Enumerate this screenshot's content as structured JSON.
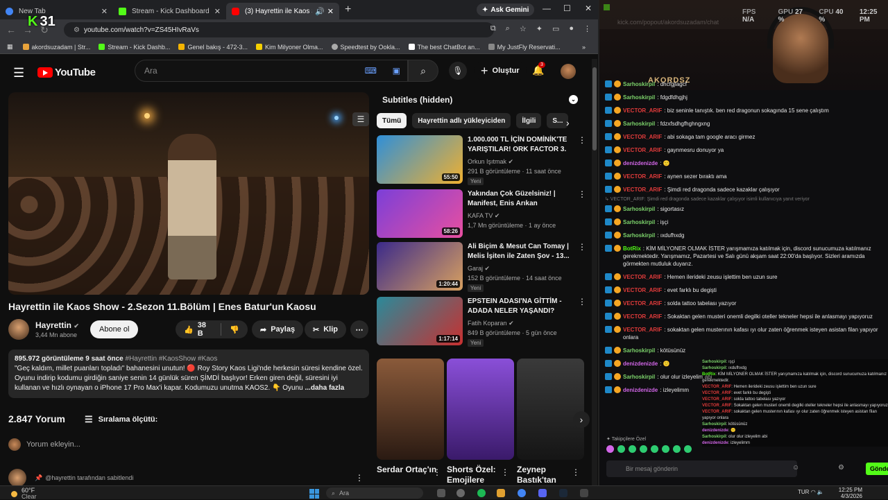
{
  "tabs": [
    {
      "title": "New Tab",
      "color": "#4285f4"
    },
    {
      "title": "Stream - Kick Dashboard",
      "color": "#53fc18"
    },
    {
      "title": "(3) Hayrettin ile Kaos Show",
      "color": "#ff0000"
    }
  ],
  "gemini_label": "Ask Gemini",
  "kick_overlay": {
    "k": "K",
    "num": "31"
  },
  "url": "youtube.com/watch?v=ZS45HIvRaVs",
  "bookmarks": [
    {
      "label": "akordsuzadam | Str...",
      "color": "#e8a33b"
    },
    {
      "label": "Stream - Kick Dashb...",
      "color": "#53fc18"
    },
    {
      "label": "Genel bakış - 472-3...",
      "color": "#f4b400"
    },
    {
      "label": "Kim Milyoner Olma...",
      "color": "#f5d000"
    },
    {
      "label": "Speedtest by Ookla...",
      "color": "#aaaaaa"
    },
    {
      "label": "The best ChatBot an...",
      "color": "#ffffff"
    },
    {
      "label": "My JustFly Reservati...",
      "color": "#888888"
    }
  ],
  "yt": {
    "logo": "YouTube",
    "search_placeholder": "Ara",
    "create_label": "Oluştur",
    "notif_count": "3"
  },
  "video": {
    "title": "Hayrettin ile Kaos Show - 2.Sezon 11.Bölüm | Enes Batur'un Kaosu",
    "channel": "Hayrettin",
    "subs": "3,44 Mn abone",
    "subscribe": "Abone ol",
    "likes": "38 B",
    "share": "Paylaş",
    "clip": "Klip",
    "desc_meta": "895.972 görüntüleme  9 saat önce",
    "desc_tags": "#Hayrettin #KaosShow #Kaos",
    "desc_text": "\"Geç kaldım, millet puanları topladı\" bahanesini unutun! 🔴 Roy Story Kaos Ligi'nde herkesin süresi kendine özel. Oyunu indirip kodumu girdiğin saniye senin 14 günlük süren ŞİMDİ başlıyor! Erken giren değil, süresini iyi kullanan ve hızlı oynayan o iPhone 17 Pro Max'i kapar. Kodumuzu unutma KAOS2. 👇 Oyunu",
    "desc_more": "...daha fazla",
    "comments_count": "2.847 Yorum",
    "sort_label": "Sıralama ölçütü:",
    "add_comment": "Yorum ekleyin...",
    "pinned": "@hayrettin tarafından sabitlendi"
  },
  "subtitles_header": "Subtitles (hidden)",
  "chips": [
    "Tümü",
    "Hayrettin adlı yükleyiciden",
    "İlgili",
    "S..."
  ],
  "recs": [
    {
      "title": "1.000.000 TL İÇİN DOMİNİK'TE YARIŞTILAR! ORK FACTOR 3. ...",
      "channel": "Orkun Işıtmak",
      "views": "291 B görüntüleme · 11 saat önce",
      "badge": "Yeni",
      "duration": "55:50",
      "c1": "#2f8fd8",
      "c2": "#f0b030"
    },
    {
      "title": "Yakından Çok Güzelsiniz! | Manifest, Enis Arıkan",
      "channel": "KAFA TV",
      "views": "1,7 Mn görüntüleme · 1 ay önce",
      "badge": "",
      "duration": "58:26",
      "c1": "#7b3fd8",
      "c2": "#e84fa0"
    },
    {
      "title": "Ali Biçim & Mesut Can Tomay | Melis İşiten ile Zaten Şov - 13...",
      "channel": "Garaj",
      "views": "152 B görüntüleme · 14 saat önce",
      "badge": "Yeni",
      "duration": "1:20:44",
      "c1": "#3b2a8a",
      "c2": "#d8a060"
    },
    {
      "title": "EPSTEIN ADASI'NA GİTTİM - ADADA NELER YAŞANDI?",
      "channel": "Fatih Koparan",
      "views": "849 B görüntüleme · 5 gün önce",
      "badge": "Yeni",
      "duration": "1:17:14",
      "c1": "#2a8a9a",
      "c2": "#c83030"
    }
  ],
  "shorts": [
    {
      "title": "Serdar Ortaç'ın",
      "c1": "#8a5a3a",
      "c2": "#2a1a12"
    },
    {
      "title": "Shorts Özel: Emojilere",
      "c1": "#8a4fd8",
      "c2": "#3a1a6a"
    },
    {
      "title": "Zeynep Bastık'tan",
      "c1": "#3a3a3a",
      "c2": "#151515"
    }
  ],
  "stream": {
    "url": "kick.com/popout/akordsuzadam/chat",
    "hud": [
      {
        "label": "FPS",
        "value": "N/A"
      },
      {
        "label": "GPU",
        "value": "27 %"
      },
      {
        "label": "CPU",
        "value": "40 %"
      },
      {
        "label": "",
        "value": "12:25 PM"
      }
    ],
    "cam_logo": "AKORDSZ",
    "chat": [
      {
        "type": "msg",
        "user": "Sarhoskirpil",
        "text": "dhcfgjlagcf",
        "color": "#7cd36b"
      },
      {
        "type": "msg",
        "user": "Sarhoskirpil",
        "text": "fdgdfdhgjhj",
        "color": "#7cd36b"
      },
      {
        "type": "msg",
        "user": "VECTOR_ARIF",
        "text": "biz seninle tanıştık. ben red dragonun sokagında 15 sene çalıştım",
        "color": "#e23b3b"
      },
      {
        "type": "msg",
        "user": "Sarhoskirpil",
        "text": "fdzxfsdhgfhghngxng",
        "color": "#7cd36b"
      },
      {
        "type": "msg",
        "user": "VECTOR_ARIF",
        "text": "abi sokaga tam google aracı girmez",
        "color": "#e23b3b"
      },
      {
        "type": "msg",
        "user": "VECTOR_ARIF",
        "text": "gaynmesru donuyor ya",
        "color": "#e23b3b"
      },
      {
        "type": "msg",
        "user": "denizdenizde",
        "text": "🙂",
        "color": "#d266e8"
      },
      {
        "type": "msg",
        "user": "VECTOR_ARIF",
        "text": "aynen sezer bıraktı ama",
        "color": "#e23b3b"
      },
      {
        "type": "msg",
        "user": "VECTOR_ARIF",
        "text": "Şimdi red dragonda sadece kazaklar çalışıyor",
        "color": "#e23b3b"
      },
      {
        "type": "reply",
        "text": "↳ VECTOR_ARIF: Şimdi red dragonda sadece kazaklar çalışıyor isimli kullanıcıya yanıt veriyor"
      },
      {
        "type": "msg",
        "user": "Sarhoskirpil",
        "text": "sigortasız",
        "color": "#7cd36b"
      },
      {
        "type": "msg",
        "user": "Sarhoskirpil",
        "text": "işçi",
        "color": "#7cd36b"
      },
      {
        "type": "msg",
        "user": "Sarhoskirpil",
        "text": "ıxdufhxdg",
        "color": "#7cd36b"
      },
      {
        "type": "msg",
        "user": "BotRix",
        "text": "KİM MİLYONER OLMAK İSTER yarışmamıza katılmak için, discord sunucumuza katılmanız gerekmektedir. Yarışmamız, Pazartesi ve Salı günü akşam saat 22:00'da başlıyor. Sizleri aramızda görmekten mutluluk duyarız.",
        "color": "#53fc18"
      },
      {
        "type": "msg",
        "user": "VECTOR_ARIF",
        "text": "Hemen ilerideki zeusu işlettim ben uzun sure",
        "color": "#e23b3b"
      },
      {
        "type": "msg",
        "user": "VECTOR_ARIF",
        "text": "evet farklı bu degişti",
        "color": "#e23b3b"
      },
      {
        "type": "msg",
        "user": "VECTOR_ARIF",
        "text": "solda tattoo tabelası yazıyor",
        "color": "#e23b3b"
      },
      {
        "type": "msg",
        "user": "VECTOR_ARIF",
        "text": "Sokaktan gelen musteri onemli degilki oteller tekneler hepsi ile anlasmayı yapıyoruz",
        "color": "#e23b3b"
      },
      {
        "type": "msg",
        "user": "VECTOR_ARIF",
        "text": "sokaktan gelen musterının kafası ıyı olur zaten öğrenmek isteyen asistan filan yapıyor onlara",
        "color": "#e23b3b"
      },
      {
        "type": "msg",
        "user": "Sarhoskirpil",
        "text": "kötüsünüz",
        "color": "#7cd36b"
      },
      {
        "type": "msg",
        "user": "denizdenizde",
        "text": "🙂",
        "color": "#d266e8"
      },
      {
        "type": "msg",
        "user": "Sarhoskirpil",
        "text": "olur olur izleyelim abi",
        "color": "#7cd36b"
      },
      {
        "type": "msg",
        "user": "denizdenizde",
        "text": "izleyelimm",
        "color": "#d266e8"
      }
    ],
    "followers_label": "Takipçilere Özel",
    "msg_placeholder": "Bir mesaj gönderin",
    "send": "Gönder",
    "overlay_lines": [
      {
        "user": "Sarhoskirpil",
        "text": "ışçi",
        "color": "#7cd36b"
      },
      {
        "user": "Sarhoskirpil",
        "text": "ıxdufhxdg",
        "color": "#7cd36b"
      },
      {
        "user": "BotRix",
        "text": "KİM MİLYONER OLMAK İSTER yarışmamıza katılmak için, discord sunucumuza katılmanız gerekmektedir.",
        "color": "#53fc18"
      },
      {
        "user": "VECTOR_ARIF",
        "text": "Hemen ilerideki zeusu işlettim ben uzun sure",
        "color": "#e23b3b"
      },
      {
        "user": "VECTOR_ARIF",
        "text": "evet farklı bu degişti",
        "color": "#e23b3b"
      },
      {
        "user": "VECTOR_ARIF",
        "text": "solda tattoo tabelası yazıyor",
        "color": "#e23b3b"
      },
      {
        "user": "VECTOR_ARIF",
        "text": "Sokaktan gelen musteri onemli degilki oteller tekneler hepsi ile anlasmayı yapıyoruz",
        "color": "#e23b3b"
      },
      {
        "user": "VECTOR_ARIF",
        "text": "sokaktan gelen musterının kafası ıyı olur zaten öğrenmek isteyen asistan filan yapıyor onlara",
        "color": "#e23b3b"
      },
      {
        "user": "Sarhoskirpil",
        "text": "kötüsünüz",
        "color": "#7cd36b"
      },
      {
        "user": "denizdenizde",
        "text": "🙂",
        "color": "#d266e8"
      },
      {
        "user": "Sarhoskirpil",
        "text": "olur olur izleyelim abi",
        "color": "#7cd36b"
      },
      {
        "user": "denizdenizde",
        "text": "izleyelimm",
        "color": "#d266e8"
      }
    ]
  },
  "taskbar": {
    "temp": "60°F",
    "weather": "Clear",
    "search": "Ara",
    "lang": "TUR",
    "time": "12:25 PM",
    "date": "4/3/2026"
  }
}
